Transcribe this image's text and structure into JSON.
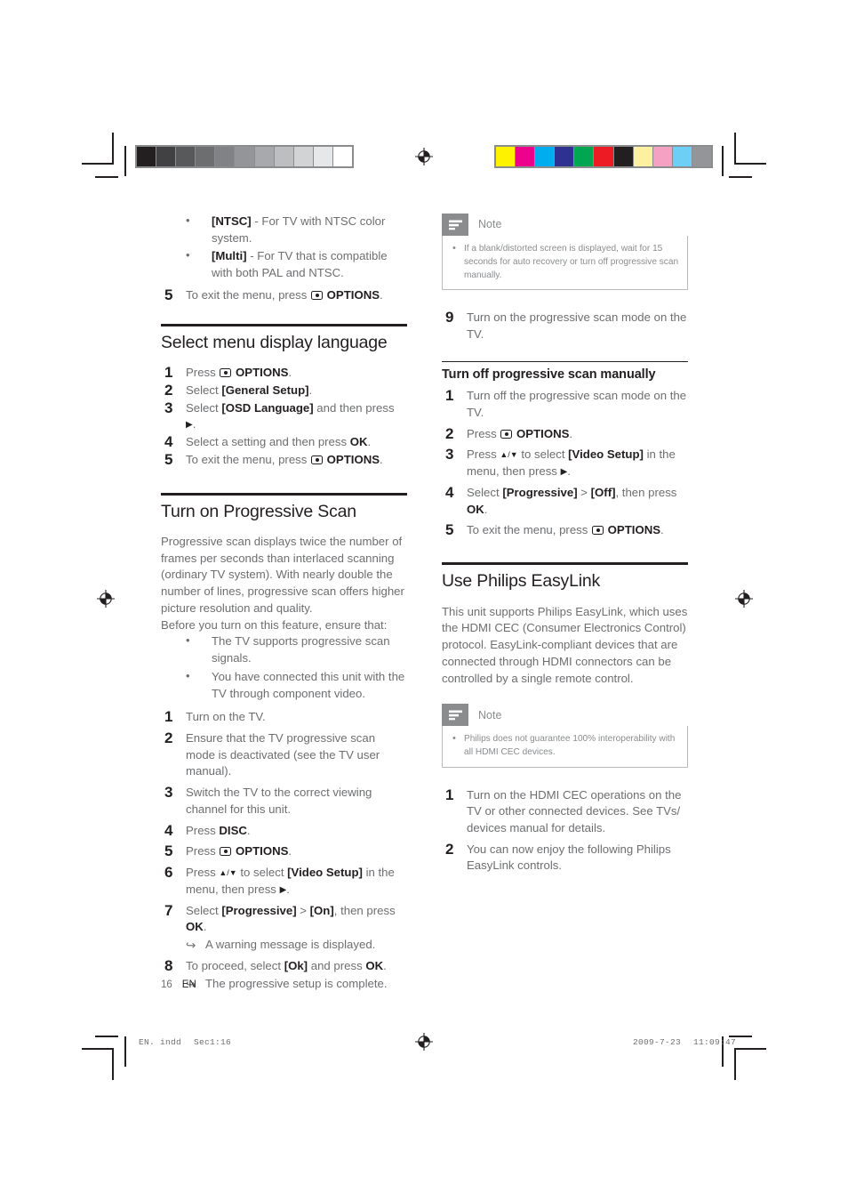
{
  "page": {
    "folio_number": "16",
    "folio_language": "EN",
    "print_footer_left": "EN. indd",
    "print_footer_left_section": "Sec1:16",
    "print_footer_date": "2009-7-23",
    "print_footer_time": "11:09:47"
  },
  "calibration": {
    "grayscale_label": "grayscale-calibration-strip",
    "grayscale_swatches": [
      "#231f20",
      "#414042",
      "#58595b",
      "#6d6e70",
      "#808285",
      "#939598",
      "#a7a9ac",
      "#bcbec0",
      "#d1d3d4",
      "#e6e7e8",
      "#ffffff"
    ],
    "color_label": "color-calibration-strip",
    "color_swatches": [
      "#fff200",
      "#ec008c",
      "#00aeef",
      "#2e3192",
      "#00a651",
      "#ed1c24",
      "#231f20",
      "#fbf1a1",
      "#f4a1c4",
      "#6dcff6",
      "#939598"
    ]
  },
  "left_column": {
    "intro_bullets": [
      {
        "token": "[NTSC]",
        "text": " - For TV with NTSC color system."
      },
      {
        "token": "[Multi]",
        "text": " - For TV that is compatible with both PAL and NTSC."
      }
    ],
    "intro_step5": {
      "number": "5",
      "prefix": "To exit the menu, press ",
      "icon": "options-icon",
      "label": "OPTIONS",
      "suffix": "."
    },
    "section_language": {
      "title": "Select menu display language",
      "steps": [
        {
          "pre": "Press ",
          "icon": "options-icon",
          "bold": "OPTIONS",
          "post": "."
        },
        {
          "pre": "Select ",
          "bold": "[General Setup]",
          "post": "."
        },
        {
          "pre": "Select ",
          "bold": "[OSD Language]",
          "post": " and then press ",
          "arrow": "▶",
          "tail": "."
        },
        {
          "pre": "Select a setting and then press ",
          "bold": "OK",
          "post": "."
        },
        {
          "pre": "To exit the menu, press ",
          "icon": "options-icon",
          "bold": "OPTIONS",
          "post": "."
        }
      ]
    },
    "section_progressive": {
      "title": "Turn on Progressive Scan",
      "paragraph1": "Progressive scan displays twice the number of frames per seconds than interlaced scanning (ordinary TV system). With nearly double the number of lines, progressive scan offers higher picture resolution and quality.",
      "paragraph2": "Before you turn on this feature, ensure that:",
      "bullets": [
        "The TV supports progressive scan signals.",
        "You have connected this unit with the TV through component video."
      ],
      "steps": [
        {
          "text": "Turn on the TV."
        },
        {
          "text": "Ensure that the TV progressive scan mode is deactivated (see the TV user manual)."
        },
        {
          "text": "Switch the TV to the correct viewing channel for this unit."
        },
        {
          "pre": "Press ",
          "bold": "DISC",
          "post": "."
        },
        {
          "pre": "Press ",
          "icon": "options-icon",
          "bold": "OPTIONS",
          "post": "."
        },
        {
          "pre": "Press ",
          "arrows": "▲/▼",
          "mid": " to select ",
          "bold": "[Video Setup]",
          "post": " in the menu, then press ",
          "arrow": "▶",
          "tail": "."
        },
        {
          "pre": "Select ",
          "bold": "[Progressive]",
          "mid": " > ",
          "bold2": "[On]",
          "post": ", then press ",
          "bold3": "OK",
          "tail": ".",
          "result": "A warning message is displayed."
        },
        {
          "pre": "To proceed, select ",
          "bold": "[Ok]",
          "post": " and press ",
          "bold2": "OK",
          "tail": ".",
          "result": "The progressive setup is complete."
        }
      ]
    }
  },
  "right_column": {
    "note1": {
      "icon": "note-icon",
      "title": "Note",
      "items": [
        "If a blank/distorted screen is displayed, wait for 15 seconds for auto recovery or turn off progressive scan manually."
      ]
    },
    "step9": {
      "number": "9",
      "text": "Turn on the progressive scan mode on the TV."
    },
    "section_turnoff": {
      "title": "Turn off progressive scan manually",
      "steps": [
        {
          "text": "Turn off the progressive scan mode on the TV."
        },
        {
          "pre": "Press ",
          "icon": "options-icon",
          "bold": "OPTIONS",
          "post": "."
        },
        {
          "pre": "Press ",
          "arrows": "▲/▼",
          "mid": " to select ",
          "bold": "[Video Setup]",
          "post": " in the menu, then press ",
          "arrow": "▶",
          "tail": "."
        },
        {
          "pre": "Select ",
          "bold": "[Progressive]",
          "mid": " > ",
          "bold2": "[Off]",
          "post": ", then press ",
          "bold3": "OK",
          "tail": "."
        },
        {
          "pre": "To exit the menu, press ",
          "icon": "options-icon",
          "bold": "OPTIONS",
          "post": "."
        }
      ]
    },
    "section_easylink": {
      "title": "Use Philips EasyLink",
      "paragraph": "This unit supports Philips EasyLink, which uses the HDMI CEC (Consumer Electronics Control) protocol. EasyLink-compliant devices that are connected through HDMI connectors can be controlled by a single remote control."
    },
    "note2": {
      "icon": "note-icon",
      "title": "Note",
      "items": [
        "Philips does not guarantee 100% interoperability with all HDMI CEC devices."
      ]
    },
    "easylink_steps": [
      {
        "text": "Turn on the HDMI CEC operations on the TV or other connected devices. See TVs/ devices manual for details."
      },
      {
        "text": "You can now enjoy the following Philips EasyLink controls."
      }
    ]
  }
}
